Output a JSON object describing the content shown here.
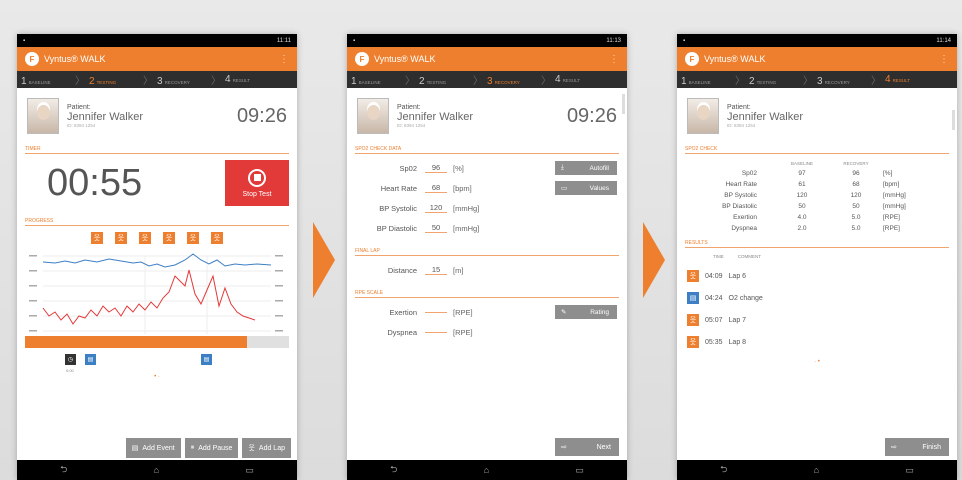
{
  "colors": {
    "accent": "#ee7f2e",
    "stop": "#e23939"
  },
  "status_time": [
    "11:11",
    "11:13",
    "11:14"
  ],
  "app_title": "Vyntus® WALK",
  "steps": [
    {
      "n": "1",
      "label": "Baseline"
    },
    {
      "n": "2",
      "label": "Testing"
    },
    {
      "n": "3",
      "label": "Recovery"
    },
    {
      "n": "4",
      "label": "Result"
    }
  ],
  "patient": {
    "label": "Patient:",
    "name": "Jennifer Walker",
    "id": "ID: 8394 1254"
  },
  "clock": "09:26",
  "screen1": {
    "timer_section": "Timer",
    "timer": "00:55",
    "stop_label": "Stop Test",
    "progress_section": "Progress",
    "event_label": "0:00",
    "buttons": {
      "event": "Add Event",
      "pause": "Add Pause",
      "lap": "Add Lap"
    }
  },
  "screen2": {
    "sprf_section": "SpO2 Check Data",
    "rows": [
      {
        "label": "Sp02",
        "value": "96",
        "unit": "[%]"
      },
      {
        "label": "Heart Rate",
        "value": "68",
        "unit": "[bpm]"
      },
      {
        "label": "BP Systolic",
        "value": "120",
        "unit": "[mmHg]"
      },
      {
        "label": "BP Diastolic",
        "value": "50",
        "unit": "[mmHg]"
      }
    ],
    "autofill": "Autofill",
    "values": "Values",
    "final_lap_section": "Final Lap",
    "distance_label": "Distance",
    "distance_value": "15",
    "distance_unit": "[m]",
    "rpe_section": "RPE Scale",
    "exertion_label": "Exertion",
    "exertion_unit": "[RPE]",
    "dyspnea_label": "Dyspnea",
    "dyspnea_unit": "[RPE]",
    "rating": "Rating",
    "next": "Next"
  },
  "screen3": {
    "check_section": "SpO2 Check",
    "col_baseline": "Baseline",
    "col_recovery": "Recovery",
    "rows": [
      {
        "label": "Sp02",
        "b": "97",
        "r": "96",
        "unit": "[%]"
      },
      {
        "label": "Heart Rate",
        "b": "61",
        "r": "68",
        "unit": "[bpm]"
      },
      {
        "label": "BP Systolic",
        "b": "120",
        "r": "120",
        "unit": "[mmHg]"
      },
      {
        "label": "BP Diastolic",
        "b": "50",
        "r": "50",
        "unit": "[mmHg]"
      },
      {
        "label": "Exertion",
        "b": "4.0",
        "r": "5.0",
        "unit": "[RPE]"
      },
      {
        "label": "Dyspnea",
        "b": "2.0",
        "r": "5.0",
        "unit": "[RPE]"
      }
    ],
    "results_section": "Results",
    "col_time": "Time",
    "col_comment": "Comment",
    "events": [
      {
        "time": "04:09",
        "comment": "Lap 6",
        "kind": "lap"
      },
      {
        "time": "04:24",
        "comment": "O2 change",
        "kind": "event"
      },
      {
        "time": "05:07",
        "comment": "Lap 7",
        "kind": "lap"
      },
      {
        "time": "05:35",
        "comment": "Lap 8",
        "kind": "lap"
      }
    ],
    "finish": "Finish"
  }
}
